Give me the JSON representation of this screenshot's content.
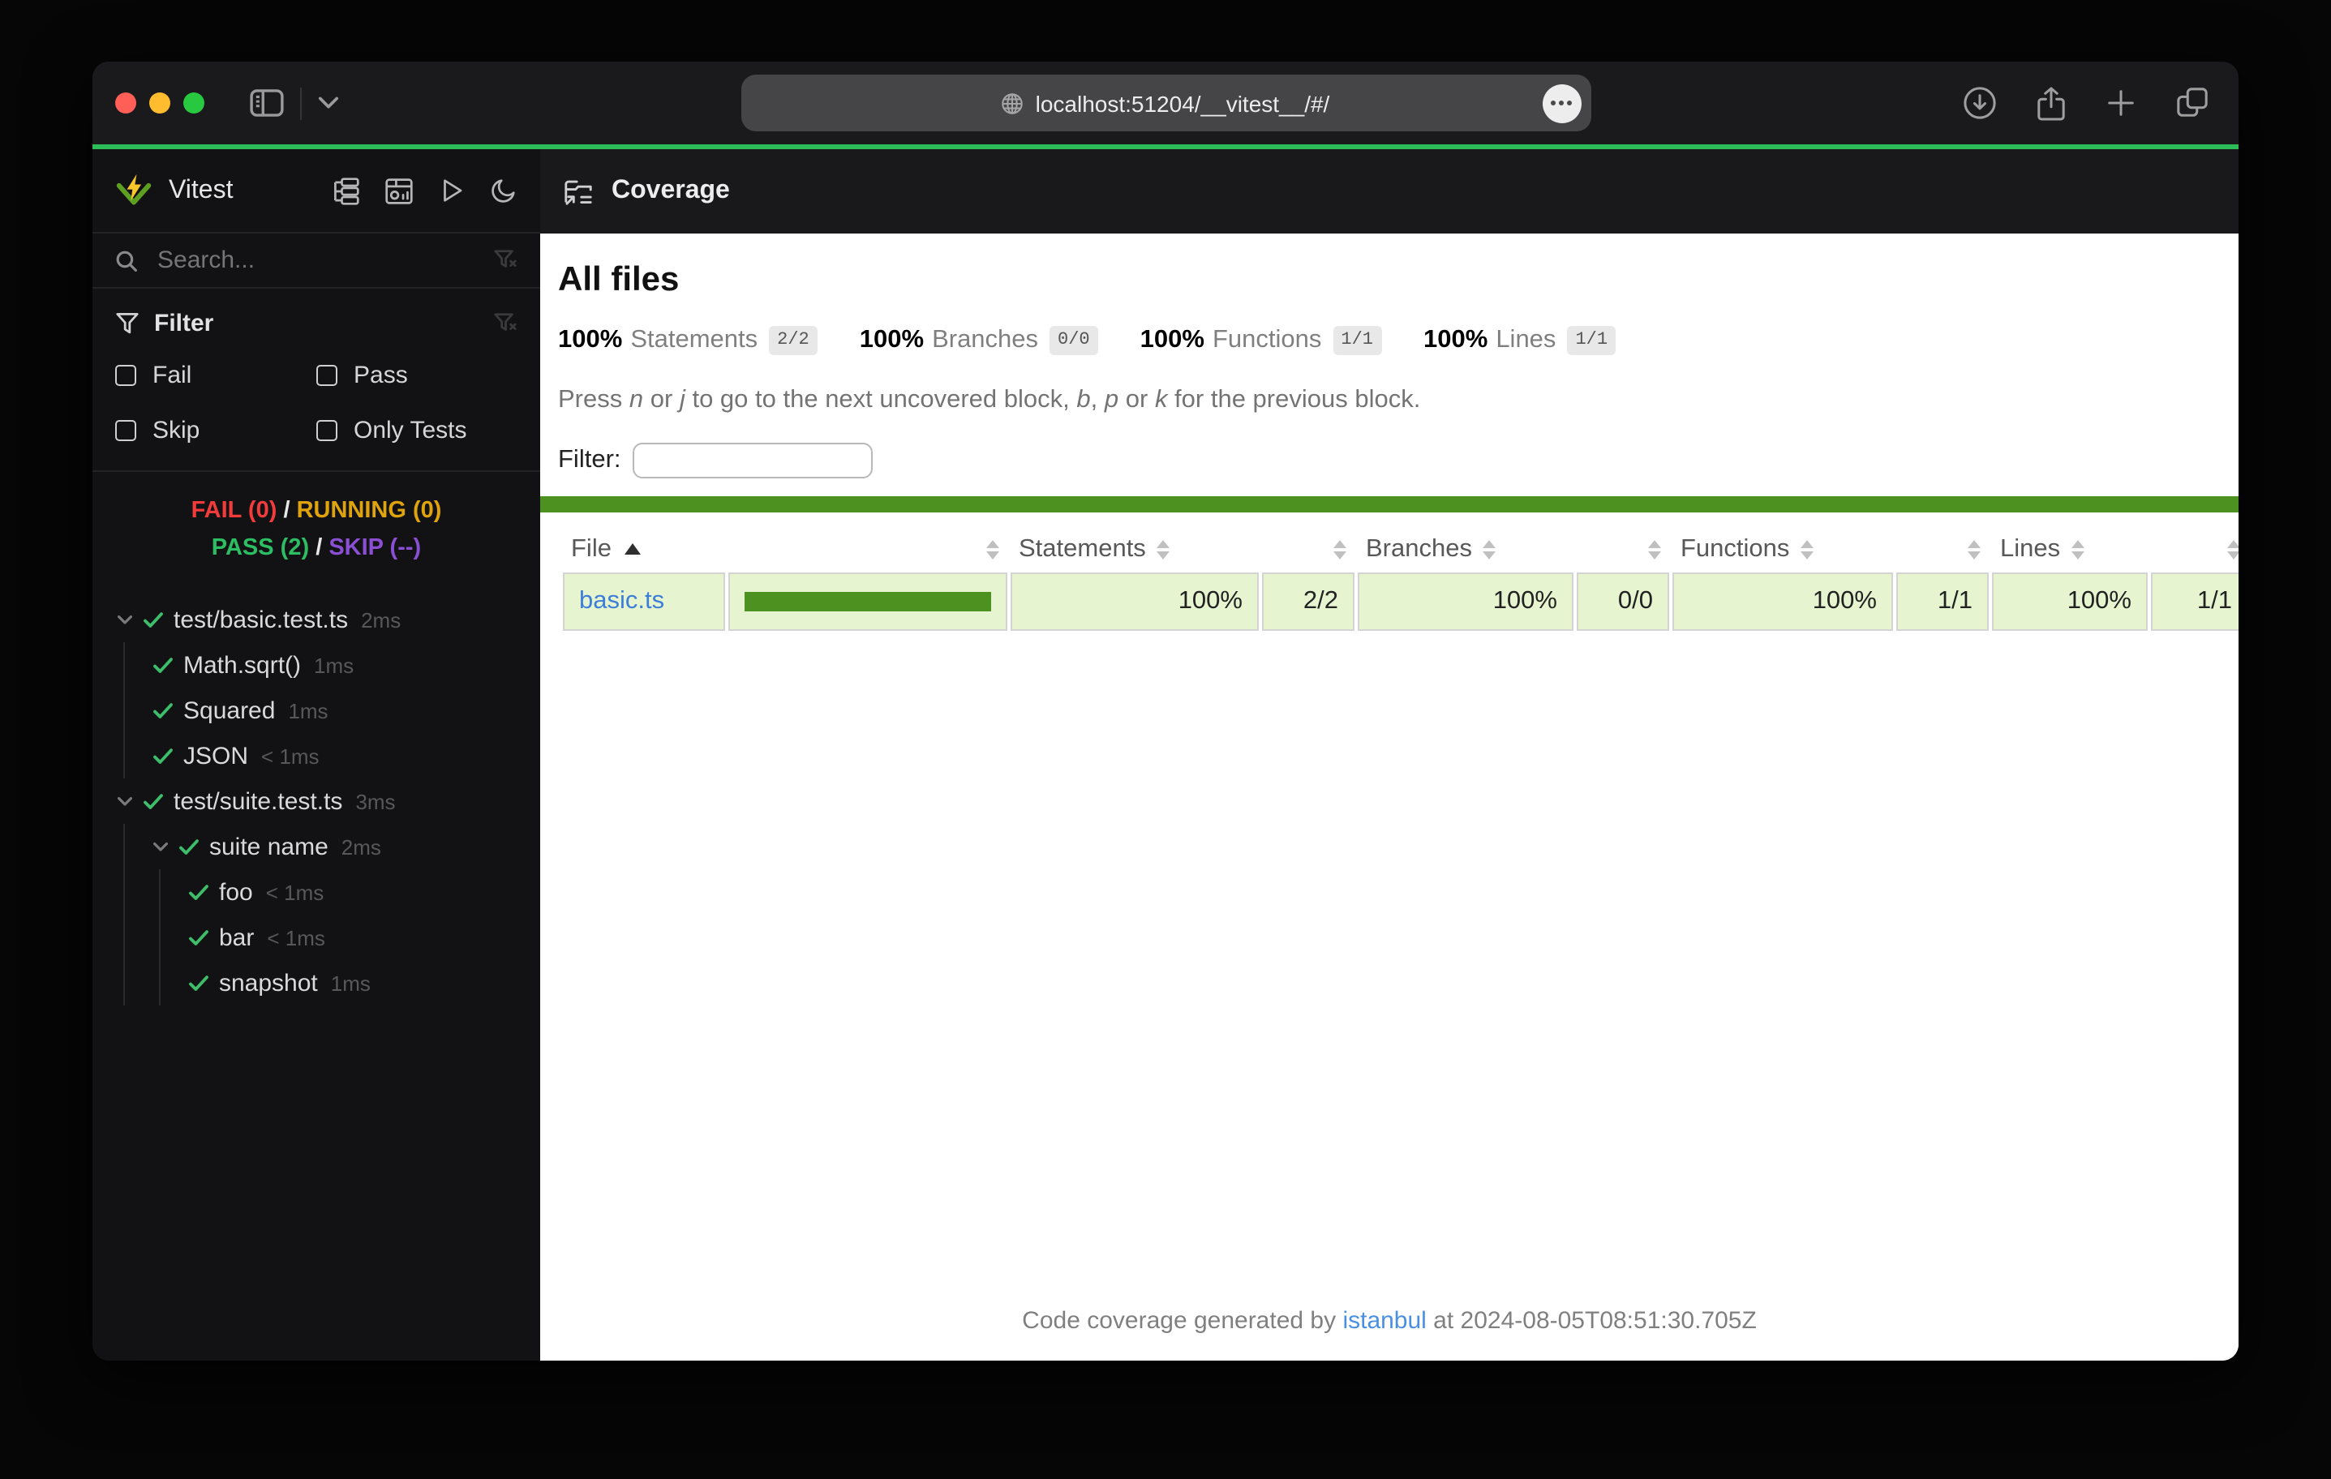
{
  "browser": {
    "url": "localhost:51204/__vitest__/#/",
    "icons": [
      "sidebar-toggle-icon",
      "chevron-down-icon",
      "globe-icon",
      "page-settings-icon",
      "download-icon",
      "share-icon",
      "new-tab-icon",
      "tab-overview-icon"
    ],
    "traffic_light_colors": {
      "close": "#ff5f57",
      "minimize": "#febc2e",
      "zoom": "#28c840"
    }
  },
  "sidebar": {
    "brand": "Vitest",
    "search_placeholder": "Search...",
    "action_icons": [
      "list-tree-icon",
      "dashboard-icon",
      "run-all-icon",
      "dark-mode-icon"
    ],
    "filter": {
      "title": "Filter",
      "options": [
        "Fail",
        "Pass",
        "Skip",
        "Only Tests"
      ]
    },
    "status": {
      "fail": "FAIL (0)",
      "running": "RUNNING (0)",
      "pass": "PASS (2)",
      "skip": "SKIP (--)",
      "separator": "/"
    },
    "tree": [
      {
        "name": "test/basic.test.ts",
        "duration": "2ms"
      },
      {
        "name": "Math.sqrt()",
        "duration": "1ms"
      },
      {
        "name": "Squared",
        "duration": "1ms"
      },
      {
        "name": "JSON",
        "duration": "< 1ms"
      },
      {
        "name": "test/suite.test.ts",
        "duration": "3ms"
      },
      {
        "name": "suite name",
        "duration": "2ms"
      },
      {
        "name": "foo",
        "duration": "< 1ms"
      },
      {
        "name": "bar",
        "duration": "< 1ms"
      },
      {
        "name": "snapshot",
        "duration": "1ms"
      }
    ]
  },
  "main": {
    "navbar_title": "Coverage",
    "heading": "All files",
    "summary": [
      {
        "pct": "100%",
        "label": "Statements",
        "fraction": "2/2"
      },
      {
        "pct": "100%",
        "label": "Branches",
        "fraction": "0/0"
      },
      {
        "pct": "100%",
        "label": "Functions",
        "fraction": "1/1"
      },
      {
        "pct": "100%",
        "label": "Lines",
        "fraction": "1/1"
      }
    ],
    "hint": [
      "Press ",
      "n",
      " or ",
      "j",
      " to go to the next uncovered block, ",
      "b",
      ", ",
      "p",
      " or ",
      "k",
      " for the previous block."
    ],
    "filter_label": "Filter:",
    "table": {
      "columns": [
        "File",
        "Statements",
        "Branches",
        "Functions",
        "Lines"
      ],
      "rows": [
        {
          "file": "basic.ts",
          "bar_fill_pct": "100%",
          "statements_pct": "100%",
          "statements": "2/2",
          "branches_pct": "100%",
          "branches": "0/0",
          "functions_pct": "100%",
          "functions": "1/1",
          "lines_pct": "100%",
          "lines": "1/1"
        }
      ]
    },
    "footer": {
      "prefix": "Code coverage generated by ",
      "link": "istanbul",
      "suffix": " at 2024-08-05T08:51:30.705Z"
    }
  },
  "colors": {
    "progress_green": "#2cbd59",
    "coverage_green": "#4d9221",
    "coverage_row_bg": "#e6f5d0",
    "fail_red": "#f23c3c",
    "running_yellow": "#dfa40b",
    "pass_green": "#2dbd63",
    "skip_purple": "#8a4fd3",
    "link_blue": "#3d7fd8"
  }
}
